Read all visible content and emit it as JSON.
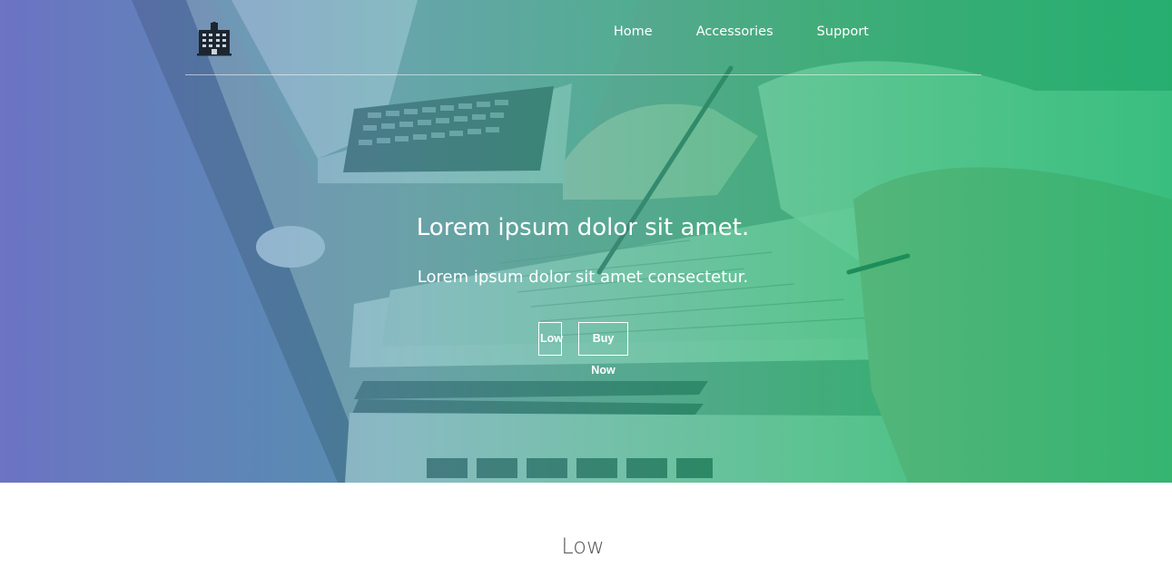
{
  "header": {
    "logo_icon": "office-building-icon",
    "nav": [
      {
        "label": "Home"
      },
      {
        "label": "Accessories"
      },
      {
        "label": "Support"
      }
    ]
  },
  "hero": {
    "title": "Lorem ipsum dolor sit amet.",
    "subtitle": "Lorem ipsum dolor sit amet consectetur.",
    "buttons": [
      {
        "label": "Low"
      },
      {
        "label": "Buy Now"
      }
    ],
    "gradient_colors": [
      "#7b73d3",
      "#35b37c",
      "#12b564"
    ]
  },
  "section": {
    "title": "Low"
  }
}
